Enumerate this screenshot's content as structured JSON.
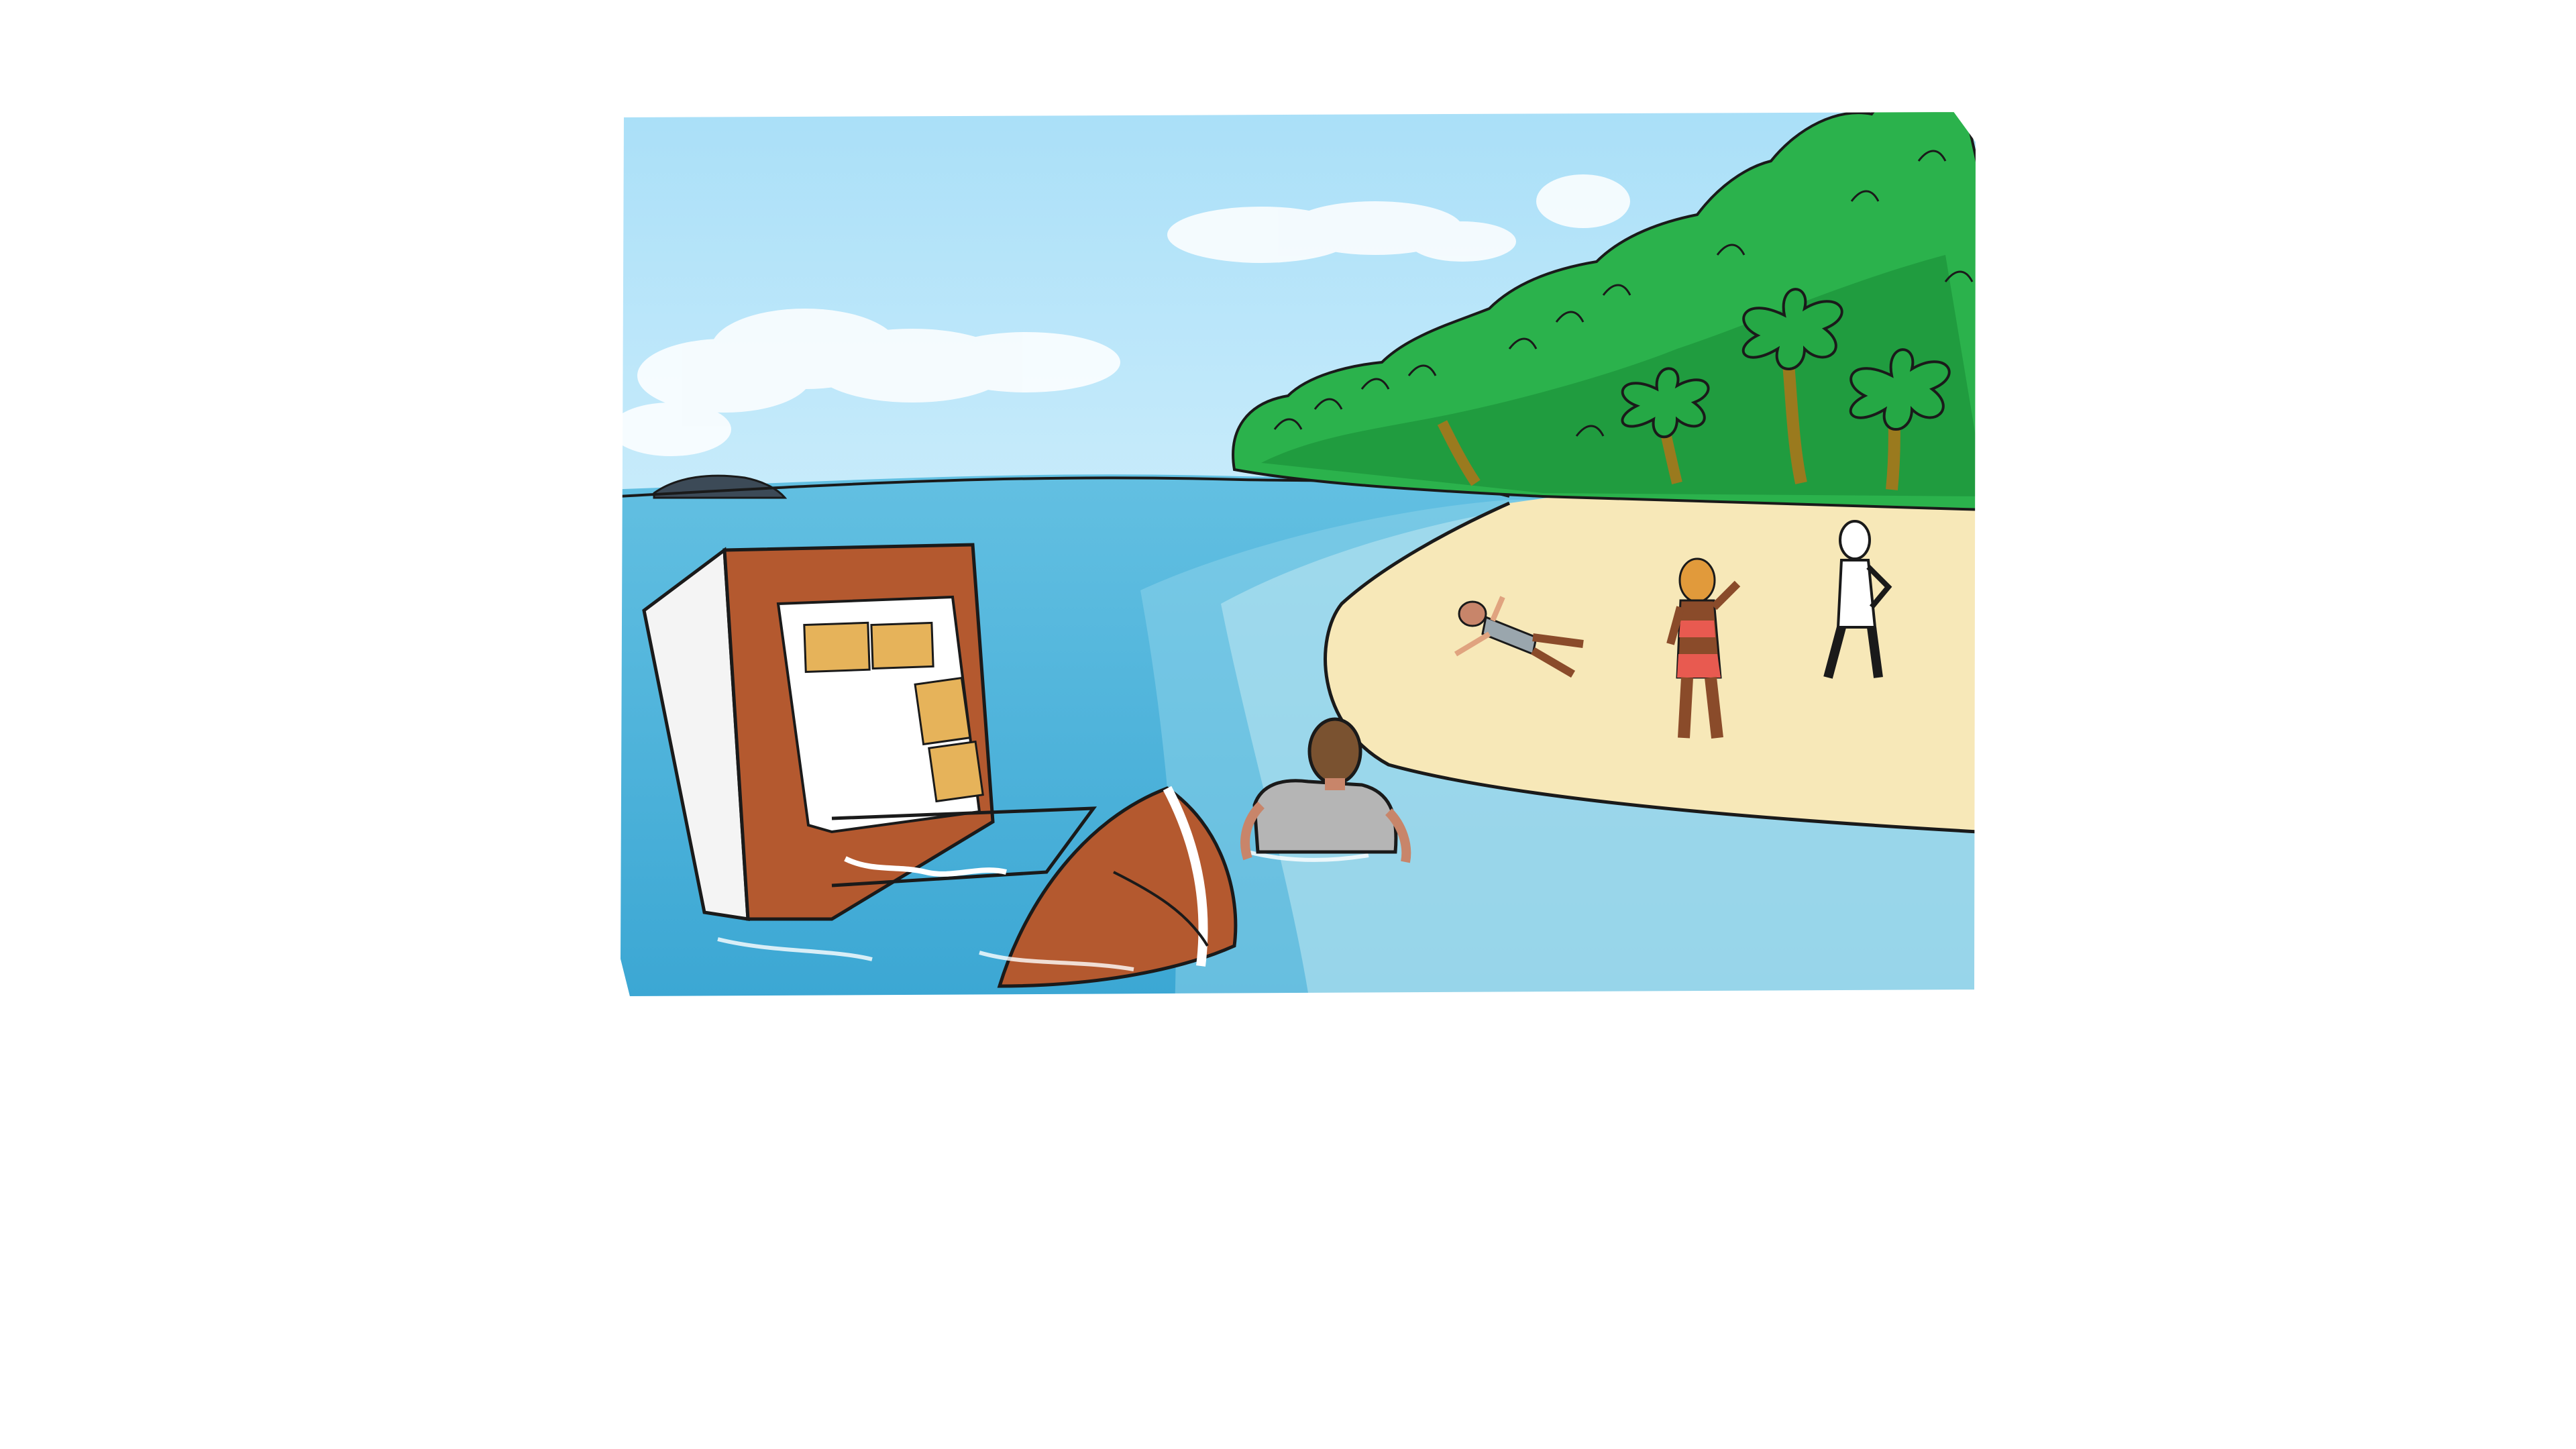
{
  "scene": {
    "colors": {
      "sky": "#b3e3fb",
      "sea": "#4fb6dc",
      "sea_deep": "#3aa6d3",
      "sand": "#f7e8b8",
      "foliage": "#2bb24c",
      "foliage_dark": "#178a34",
      "hull": "#b4592f",
      "skin": "#8a4b2a",
      "swimsuit": "#e85a50"
    },
    "icons": [
      "capsized-boat-icon",
      "palm-tree-icon",
      "person-icon"
    ]
  }
}
